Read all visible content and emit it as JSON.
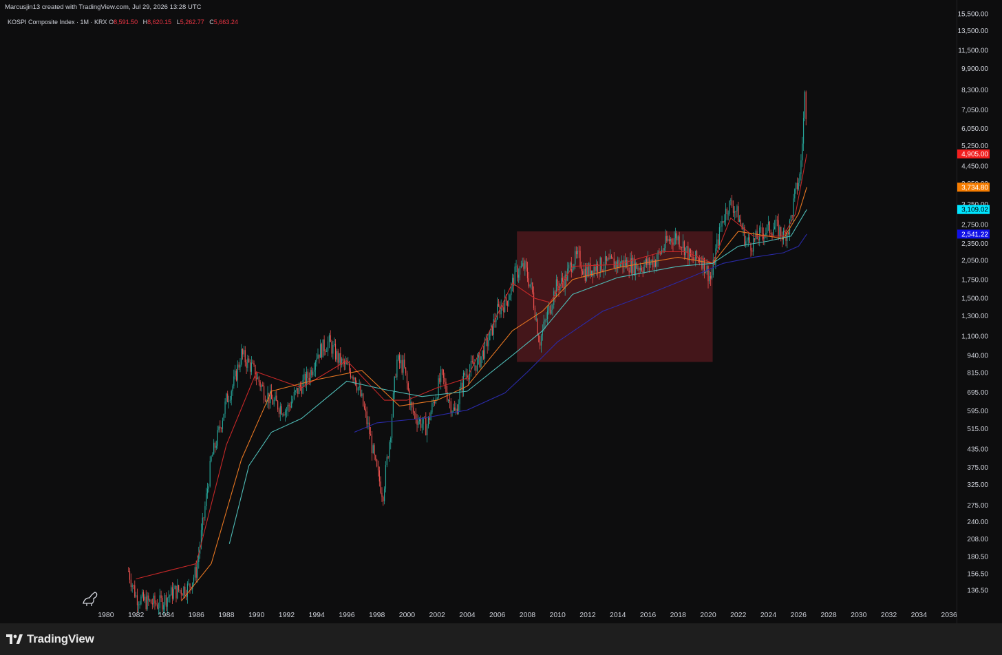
{
  "header": {
    "credit": "Marcusjin13 created with TradingView.com, Jul 29, 2026 13:28 UTC"
  },
  "legend": {
    "symbol": "KOSPI Composite Index · 1M · KRX",
    "o_key": "O",
    "o_val": "8,591.50",
    "h_key": "H",
    "h_val": "8,620.15",
    "l_key": "L",
    "l_val": "5,262.77",
    "c_key": "C",
    "c_val": "5,663.24"
  },
  "footer": {
    "brand": "TradingView"
  },
  "colors": {
    "background": "#0d0d0e",
    "up": "#26a69a",
    "down": "#ef5350",
    "ma_red": "#c62828",
    "ma_orange": "#e87722",
    "ma_teal": "#4fbcb7",
    "ma_blue": "#2a2aa8",
    "zone_fill": "#5a1b20"
  },
  "chart_data": {
    "type": "line",
    "title": "KOSPI Composite Index · 1M · KRX",
    "y_scale": "log",
    "xlim": [
      1979.0,
      2036.5
    ],
    "ylim": [
      120,
      15500
    ],
    "x_ticks": [
      1980,
      1982,
      1984,
      1986,
      1988,
      1990,
      1992,
      1994,
      1996,
      1998,
      2000,
      2002,
      2004,
      2006,
      2008,
      2010,
      2012,
      2014,
      2016,
      2018,
      2020,
      2022,
      2024,
      2026,
      2028,
      2030,
      2032,
      2034,
      2036
    ],
    "x_tick_labels": [
      "1980",
      "1982",
      "1984",
      "1986",
      "1988",
      "1990",
      "1992",
      "1994",
      "1996",
      "1998",
      "2000",
      "2002",
      "2004",
      "2006",
      "2008",
      "2010",
      "2012",
      "2014",
      "2016",
      "2018",
      "2020",
      "2022",
      "2024",
      "2026",
      "2028",
      "2030",
      "2032",
      "2034",
      "2036"
    ],
    "y_ticks": [
      136.5,
      156.5,
      180.5,
      208,
      240,
      275,
      325,
      375,
      435,
      515,
      595,
      695,
      815,
      940,
      1100,
      1300,
      1500,
      1750,
      2050,
      2350,
      2750,
      3250,
      3850,
      4450,
      5250,
      6050,
      7050,
      8300,
      9900,
      11500,
      13500,
      15500
    ],
    "y_tick_labels": [
      "136.50",
      "156.50",
      "180.50",
      "208.00",
      "240.00",
      "275.00",
      "325.00",
      "375.00",
      "435.00",
      "515.00",
      "595.00",
      "695.00",
      "815.00",
      "940.00",
      "1,100.00",
      "1,300.00",
      "1,500.00",
      "1,750.00",
      "2,050.00",
      "2,350.00",
      "2,750.00",
      "3,250.00",
      "3,850.00",
      "4,450.00",
      "5,250.00",
      "6,050.00",
      "7,050.00",
      "8,300.00",
      "9,900.00",
      "11,500.00",
      "13,500.00",
      "15,500.00"
    ],
    "price_series": {
      "x": [
        1981.5,
        1982.0,
        1982.5,
        1983.5,
        1984.5,
        1985.5,
        1986.0,
        1986.5,
        1987.0,
        1987.5,
        1988.0,
        1988.5,
        1989.0,
        1989.3,
        1989.7,
        1990.5,
        1991.0,
        1991.5,
        1992.0,
        1992.7,
        1993.5,
        1994.0,
        1994.8,
        1995.5,
        1996.0,
        1996.5,
        1997.0,
        1997.5,
        1997.9,
        1998.4,
        1998.9,
        1999.3,
        1999.8,
        2000.3,
        2000.8,
        2001.3,
        2001.8,
        2002.3,
        2002.8,
        2003.2,
        2003.8,
        2004.3,
        2004.8,
        2005.5,
        2006.0,
        2006.7,
        2007.2,
        2007.8,
        2008.3,
        2008.8,
        2009.3,
        2009.9,
        2010.5,
        2011.0,
        2011.4,
        2011.8,
        2012.5,
        2013.5,
        2014.5,
        2015.5,
        2016.5,
        2017.3,
        2017.9,
        2018.4,
        2018.9,
        2019.5,
        2020.2,
        2020.5,
        2020.9,
        2021.3,
        2021.6,
        2022.0,
        2022.5,
        2022.9,
        2023.5,
        2024.0,
        2024.5,
        2025.0,
        2025.4,
        2025.8,
        2026.1,
        2026.3,
        2026.45,
        2026.55
      ],
      "close": [
        160,
        130,
        125,
        122,
        135,
        140,
        160,
        250,
        400,
        500,
        650,
        750,
        950,
        900,
        850,
        700,
        650,
        620,
        600,
        700,
        800,
        950,
        1050,
        900,
        850,
        800,
        650,
        500,
        380,
        300,
        500,
        900,
        850,
        600,
        550,
        520,
        650,
        800,
        650,
        580,
        800,
        850,
        900,
        1100,
        1350,
        1500,
        1850,
        1950,
        1600,
        1050,
        1300,
        1650,
        1750,
        2050,
        2100,
        1850,
        1950,
        2000,
        2000,
        1950,
        2050,
        2400,
        2500,
        2300,
        2050,
        2100,
        1750,
        2200,
        2800,
        3200,
        3250,
        2950,
        2400,
        2350,
        2550,
        2650,
        2700,
        2500,
        2700,
        3600,
        4100,
        6000,
        8600,
        5663
      ]
    },
    "series": [
      {
        "label": "4,905.00",
        "color": "#c62828",
        "x": [
          1982.0,
          1986.0,
          1988.0,
          1990.0,
          1993.0,
          1996.0,
          1998.5,
          2000.0,
          2002.0,
          2004.0,
          2007.0,
          2008.5,
          2009.5,
          2011.0,
          2014.0,
          2017.0,
          2018.5,
          2020.3,
          2021.5,
          2023.0,
          2025.0,
          2025.8,
          2026.2,
          2026.55
        ],
        "values": [
          150,
          170,
          450,
          820,
          720,
          900,
          650,
          650,
          720,
          780,
          1700,
          1500,
          1450,
          1950,
          1980,
          2200,
          2200,
          2000,
          2900,
          2500,
          2500,
          3000,
          3900,
          4905
        ]
      },
      {
        "label": "3,734.80",
        "color": "#e87722",
        "x": [
          1985.0,
          1987.0,
          1989.0,
          1991.0,
          1994.0,
          1997.0,
          1999.5,
          2002.0,
          2004.0,
          2007.0,
          2009.0,
          2011.0,
          2014.0,
          2018.0,
          2020.3,
          2022.0,
          2025.0,
          2026.0,
          2026.55
        ],
        "values": [
          125,
          170,
          400,
          700,
          770,
          830,
          620,
          650,
          730,
          1150,
          1350,
          1750,
          1930,
          2100,
          2000,
          2600,
          2450,
          3000,
          3734.8
        ]
      },
      {
        "label": "3,109.02",
        "color": "#4fbcb7",
        "x": [
          1988.2,
          1989.5,
          1991.0,
          1993.0,
          1996.0,
          1998.5,
          2001.0,
          2004.0,
          2007.0,
          2009.0,
          2011.0,
          2014.0,
          2018.0,
          2020.3,
          2022.0,
          2024.0,
          2025.5,
          2026.55
        ],
        "values": [
          200,
          380,
          500,
          560,
          760,
          710,
          670,
          700,
          940,
          1150,
          1550,
          1780,
          1950,
          2000,
          2300,
          2400,
          2500,
          3109.02
        ]
      },
      {
        "label": "2,541.22",
        "color": "#2a2aa8",
        "x": [
          1996.5,
          1998.0,
          2001.0,
          2004.0,
          2006.5,
          2008.0,
          2010.0,
          2013.0,
          2016.0,
          2019.0,
          2021.0,
          2023.0,
          2025.0,
          2026.0,
          2026.55
        ],
        "values": [
          500,
          540,
          560,
          600,
          690,
          820,
          1050,
          1350,
          1550,
          1800,
          2000,
          2100,
          2180,
          2300,
          2541.22
        ]
      }
    ],
    "price_labels": [
      {
        "value": 4905.0,
        "text": "4,905.00",
        "color": "#f21e1e"
      },
      {
        "value": 3734.8,
        "text": "3,734.80",
        "color": "#f57c00"
      },
      {
        "value": 3109.02,
        "text": "3,109.02",
        "color": "#00e5ff"
      },
      {
        "value": 2541.22,
        "text": "2,541.22",
        "color": "#1010e6"
      }
    ],
    "zone": {
      "x0": 2007.3,
      "x1": 2020.3,
      "y0": 890,
      "y1": 2600
    },
    "grid": false
  }
}
